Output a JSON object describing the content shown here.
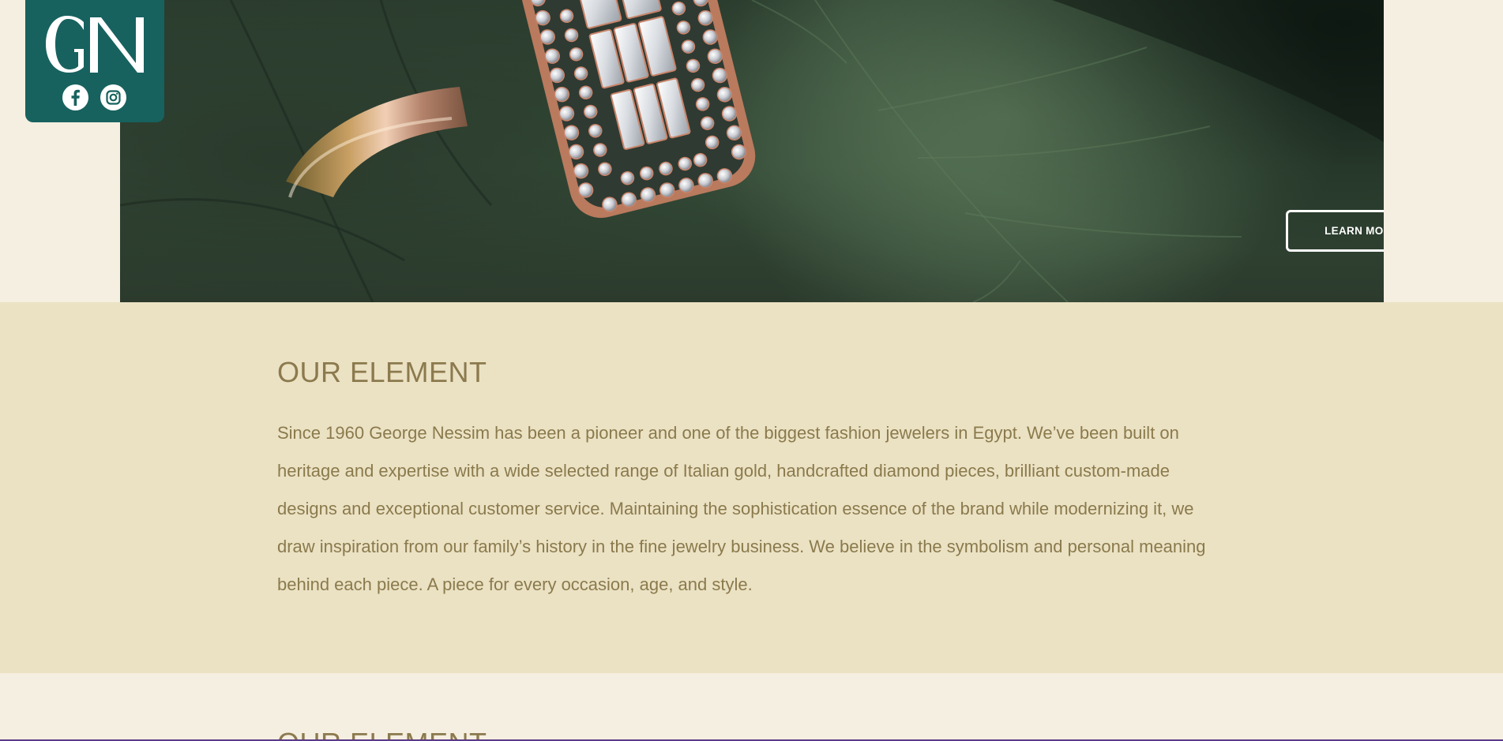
{
  "brand": {
    "logo_text": "GN",
    "logo_color": "#17625f",
    "social": [
      {
        "icon": "facebook-icon"
      },
      {
        "icon": "instagram-icon"
      }
    ]
  },
  "hero": {
    "image": "diamond-ring-on-green-leaf",
    "cta_label": "LEARN MORE"
  },
  "about": {
    "heading": "OUR ELEMENT",
    "body": "Since 1960 George Nessim has been a pioneer and one of the biggest fashion jewelers in Egypt. We’ve been built on heritage and expertise with a wide selected range of Italian gold, handcrafted diamond pieces, brilliant custom-made designs and exceptional customer service. Maintaining the sophistication essence of the brand while modernizing it, we draw inspiration from our family’s history in the fine jewelry business. We believe in the symbolism and personal meaning behind each piece. A piece for every occasion, age, and style."
  },
  "next_section": {
    "heading": "OUR ELEMENT"
  },
  "colors": {
    "page_bg": "#f5efe1",
    "section_bg": "#ebe2c4",
    "text": "#8a7a4c",
    "accent": "#17625f"
  }
}
